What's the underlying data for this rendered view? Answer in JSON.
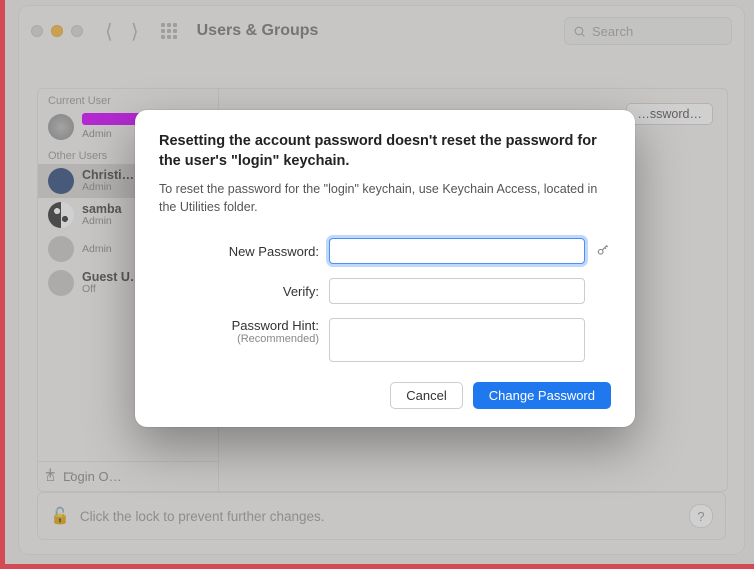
{
  "window": {
    "title": "Users & Groups",
    "search_placeholder": "Search"
  },
  "users": {
    "current_section": "Current User",
    "current": {
      "name_redacted": true,
      "role": "Admin"
    },
    "other_section": "Other Users",
    "list": [
      {
        "name": "Christi…",
        "role": "Admin",
        "selected": true
      },
      {
        "name": "samba",
        "role": "Admin"
      },
      {
        "name": "",
        "role": "Admin"
      },
      {
        "name": "Guest U…",
        "role": "Off"
      }
    ],
    "login_options": "Login O…"
  },
  "right": {
    "reset_button": "…ssword…"
  },
  "footer": {
    "lock_text": "Click the lock to prevent further changes.",
    "help": "?"
  },
  "addremove": {
    "plus": "+",
    "minus": "−"
  },
  "modal": {
    "heading": "Resetting the account password doesn't reset the password for the user's \"login\" keychain.",
    "sub": "To reset the password for the \"login\" keychain, use Keychain Access, located in the Utilities folder.",
    "labels": {
      "new_password": "New Password:",
      "verify": "Verify:",
      "hint": "Password Hint:",
      "hint_sub": "(Recommended)"
    },
    "buttons": {
      "cancel": "Cancel",
      "change": "Change Password"
    }
  }
}
